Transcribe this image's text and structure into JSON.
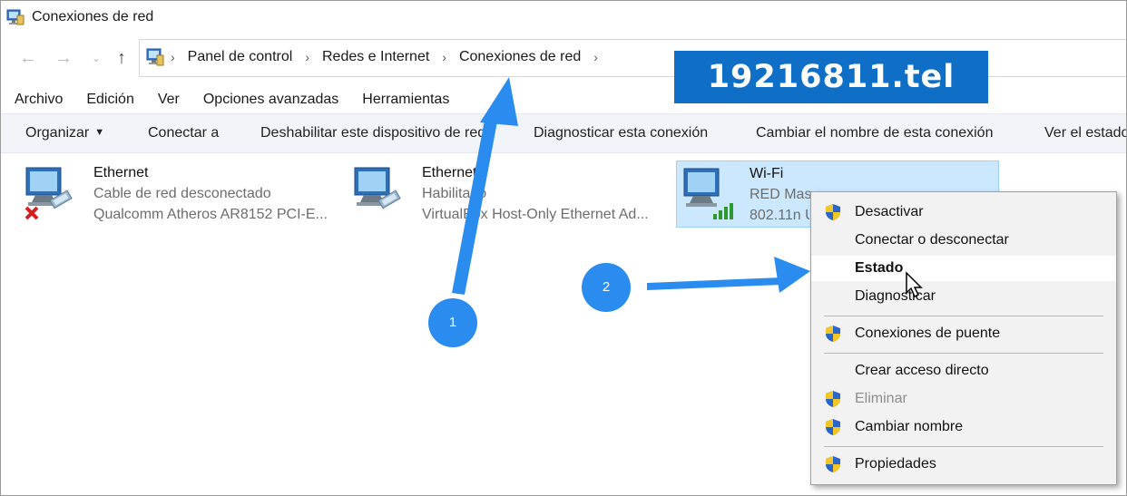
{
  "window": {
    "title": "Conexiones de red"
  },
  "address": {
    "crumbs": [
      "Panel de control",
      "Redes e Internet",
      "Conexiones de red"
    ]
  },
  "menubar": [
    "Archivo",
    "Edición",
    "Ver",
    "Opciones avanzadas",
    "Herramientas"
  ],
  "toolbar": {
    "organize": "Organizar",
    "connect_to": "Conectar a",
    "disable": "Deshabilitar este dispositivo de red",
    "diagnose": "Diagnosticar esta conexión",
    "rename": "Cambiar el nombre de esta conexión",
    "status": "Ver el estado"
  },
  "connections": [
    {
      "name": "Ethernet",
      "status": "Cable de red desconectado",
      "device": "Qualcomm Atheros AR8152 PCI-E...",
      "icon": "ethernet-disconnected-icon"
    },
    {
      "name": "Ethernet",
      "status": "Habilitado",
      "device": "VirtualBox Host-Only Ethernet Ad...",
      "icon": "ethernet-icon"
    },
    {
      "name": "Wi-Fi",
      "status": "RED Mas",
      "device": "802.11n U",
      "icon": "wifi-signal-icon"
    }
  ],
  "context_menu": [
    {
      "label": "Desactivar",
      "shield": true,
      "bold": false,
      "disabled": false
    },
    {
      "label": "Conectar o desconectar",
      "shield": false,
      "bold": false,
      "disabled": false
    },
    {
      "label": "Estado",
      "shield": false,
      "bold": true,
      "disabled": false
    },
    {
      "label": "Diagnosticar",
      "shield": false,
      "bold": false,
      "disabled": false
    },
    {
      "label": "Conexiones de puente",
      "shield": true,
      "bold": false,
      "disabled": false
    },
    {
      "label": "Crear acceso directo",
      "shield": false,
      "bold": false,
      "disabled": false
    },
    {
      "label": "Eliminar",
      "shield": true,
      "bold": false,
      "disabled": true
    },
    {
      "label": "Cambiar nombre",
      "shield": true,
      "bold": false,
      "disabled": false
    },
    {
      "label": "Propiedades",
      "shield": true,
      "bold": false,
      "disabled": false
    }
  ],
  "annotations": {
    "watermark": "19216811.tel",
    "step1": "1",
    "step2": "2"
  },
  "colors": {
    "selection": "#cce8ff",
    "annotation_blue": "#2b8cf0",
    "watermark_bg": "#0f6fc6"
  }
}
